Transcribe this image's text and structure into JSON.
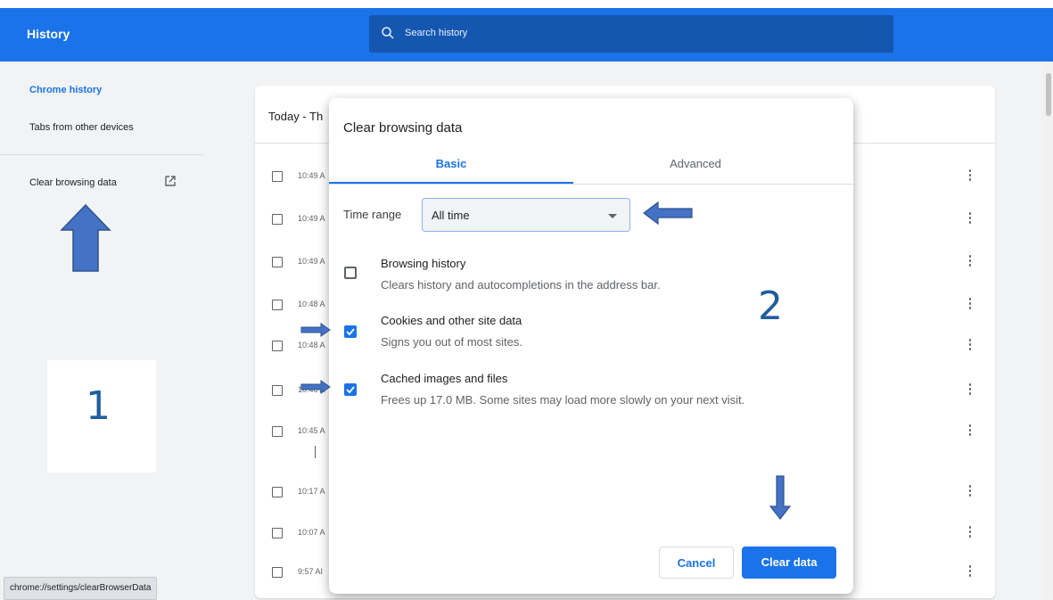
{
  "app": {
    "title": "History"
  },
  "search": {
    "placeholder": "Search history"
  },
  "sidebar": {
    "items": [
      {
        "label": "Chrome history"
      },
      {
        "label": "Tabs from other devices"
      },
      {
        "label": "Clear browsing data"
      }
    ]
  },
  "history": {
    "date_heading": "Today - Th",
    "rows": [
      {
        "time": "10:49 A"
      },
      {
        "time": "10:49 A"
      },
      {
        "time": "10:49 A"
      },
      {
        "time": "10:48 A"
      },
      {
        "time": "10:48 A"
      },
      {
        "time": "10:46 A"
      },
      {
        "time": "10:45 A"
      },
      {
        "time": "10:17 A"
      },
      {
        "time": "10:07 A"
      },
      {
        "time": "9:57 AI"
      }
    ]
  },
  "dialog": {
    "title": "Clear browsing data",
    "tabs": [
      {
        "label": "Basic"
      },
      {
        "label": "Advanced"
      }
    ],
    "time_range": {
      "label": "Time range",
      "value": "All time"
    },
    "options": [
      {
        "title": "Browsing history",
        "description": "Clears history and autocompletions in the address bar.",
        "checked": false
      },
      {
        "title": "Cookies and other site data",
        "description": "Signs you out of most sites.",
        "checked": true
      },
      {
        "title": "Cached images and files",
        "description": "Frees up 17.0 MB. Some sites may load more slowly on your next visit.",
        "checked": true
      }
    ],
    "buttons": {
      "cancel": "Cancel",
      "clear": "Clear data"
    }
  },
  "status_bar": {
    "url": "chrome://settings/clearBrowserData"
  },
  "annotations": {
    "step1": "1",
    "step2": "2"
  },
  "colors": {
    "accent": "#1a73e8",
    "arrow": "#4472c4"
  }
}
